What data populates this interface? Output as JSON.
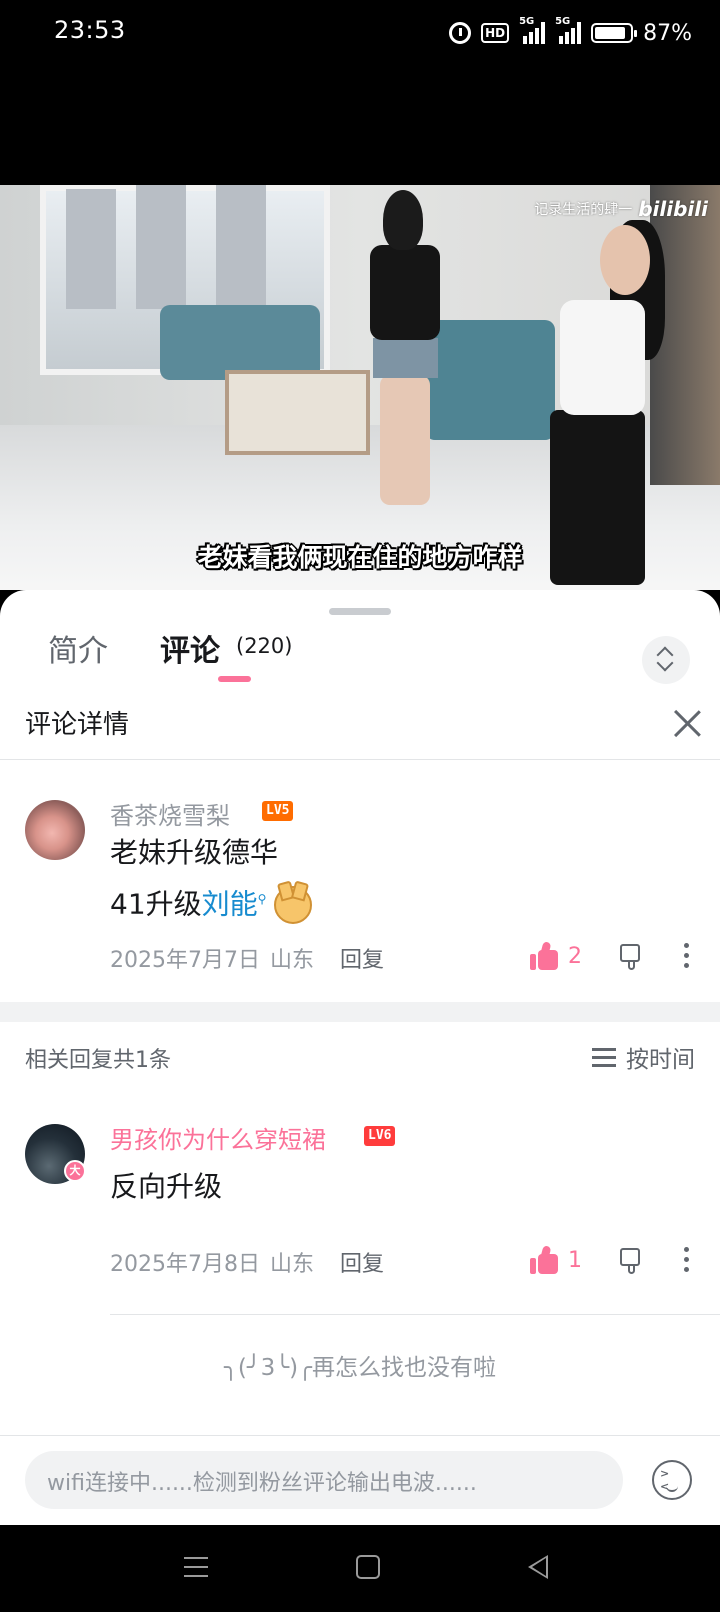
{
  "status_bar": {
    "time": "23:53",
    "network_hd": "HD",
    "network_1": "5G",
    "network_2": "5G",
    "battery_percent": "87%",
    "battery_level": 0.87
  },
  "video": {
    "watermark_text": "记录生活的肆一",
    "watermark_brand": "bilibili",
    "subtitle": "老妹看我俩现在住的地方咋样"
  },
  "tabs": {
    "intro_label": "简介",
    "comments_label": "评论",
    "comments_count": "(220)"
  },
  "detail": {
    "title": "评论详情"
  },
  "root_comment": {
    "username": "香茶烧雪梨",
    "level": "LV5",
    "level_color": "#ff6c00",
    "username_color": "#9499a0",
    "line1": "老妹升级德华",
    "line2_prefix": "41升级",
    "line2_link": "刘能",
    "date": "2025年7月7日",
    "location": "山东",
    "reply_label": "回复",
    "like_count": "2"
  },
  "replies_header": {
    "summary": "相关回复共1条",
    "sort_label": "按时间"
  },
  "reply": {
    "username": "男孩你为什么穿短裙",
    "level": "LV6",
    "level_color": "#ff3c3c",
    "username_color": "#fb7299",
    "badge": "大",
    "text": "反向升级",
    "date": "2025年7月8日",
    "location": "山东",
    "reply_label": "回复",
    "like_count": "1"
  },
  "end_note": "╮(╯3╰)╭再怎么找也没有啦",
  "input": {
    "placeholder": "wifi连接中......检测到粉丝评论输出电波......"
  },
  "colors": {
    "accent_pink": "#fb7299",
    "link_blue": "#178bcf"
  }
}
